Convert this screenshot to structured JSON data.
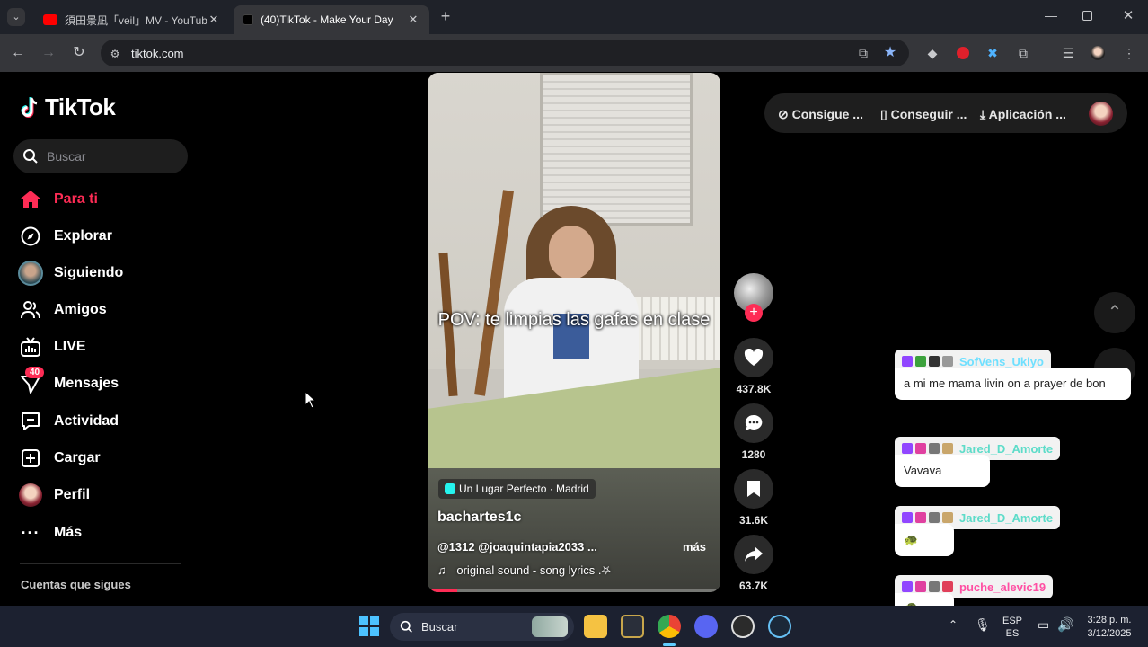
{
  "browser": {
    "tabs": [
      {
        "title": "須田景凪「veil」MV - YouTube",
        "active": false
      },
      {
        "title": "(40)TikTok - Make Your Day",
        "active": true
      }
    ],
    "url": "tiktok.com"
  },
  "tiktok": {
    "logo": "TikTok",
    "search_placeholder": "Buscar",
    "nav": [
      {
        "label": "Para ti",
        "icon": "home-icon"
      },
      {
        "label": "Explorar",
        "icon": "compass-icon"
      },
      {
        "label": "Siguiendo",
        "icon": "following-avatar-icon"
      },
      {
        "label": "Amigos",
        "icon": "friends-icon"
      },
      {
        "label": "LIVE",
        "icon": "live-icon"
      },
      {
        "label": "Mensajes",
        "icon": "messages-icon",
        "badge": "40"
      },
      {
        "label": "Actividad",
        "icon": "activity-icon"
      },
      {
        "label": "Cargar",
        "icon": "upload-icon"
      },
      {
        "label": "Perfil",
        "icon": "profile-avatar-icon"
      },
      {
        "label": "Más",
        "icon": "more-icon"
      }
    ],
    "following_title": "Cuentas que sigues",
    "top_buttons": [
      "Consigue ...",
      "Conseguir ...",
      "Aplicación ..."
    ],
    "video": {
      "caption": "POV: te limpias las gafas en clase",
      "location": "Un Lugar Perfecto · Madrid",
      "author": "bachartes1c",
      "description": "@1312 @joaquintapia2033 ...",
      "more": "más",
      "sound": "original sound - song lyrics .⛧",
      "progress": 0.1
    },
    "actions": {
      "likes": "437.8K",
      "comments": "1280",
      "saves": "31.6K",
      "shares": "63.7K"
    }
  },
  "chat": [
    {
      "name": "SofVens_Ukiyo",
      "name_color": "#6fe0ff",
      "message": "a mi me mama livin on a prayer de bon"
    },
    {
      "name": "Jared_D_Amorte",
      "name_color": "#5ddcc9",
      "message": "Vavava"
    },
    {
      "name": "Jared_D_Amorte",
      "name_color": "#5ddcc9",
      "message": "🐢"
    },
    {
      "name": "puche_alevic19",
      "name_color": "#ff4fa3",
      "message": "🐢"
    }
  ],
  "taskbar": {
    "search_label": "Buscar",
    "lang_top": "ESP",
    "lang_bottom": "ES",
    "time": "3:28 p. m.",
    "date": "3/12/2025"
  }
}
